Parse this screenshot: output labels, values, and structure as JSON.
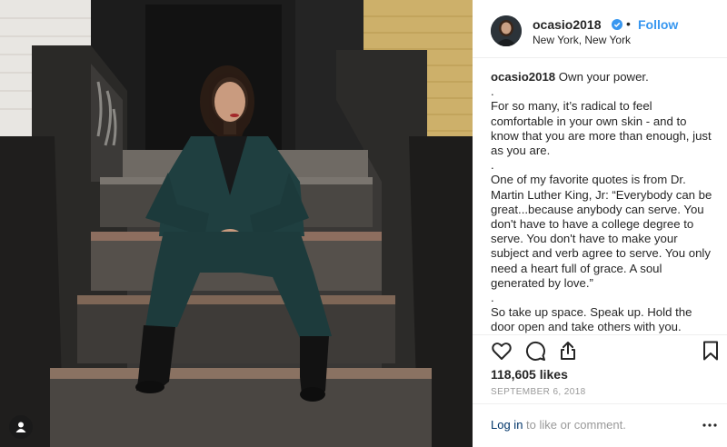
{
  "post": {
    "username": "ocasio2018",
    "follow_label": "Follow",
    "separator": "•",
    "location": "New York, New York",
    "caption_username": "ocasio2018",
    "caption_lines": [
      " Own your power.",
      ".",
      "For so many, it’s radical to feel comfortable in your own skin - and to know that you are more than enough, just as you are.",
      ".",
      "One of my favorite quotes is from Dr. Martin Luther King, Jr: “Everybody can be great...because anybody can serve. You don't have to have a college degree to serve. You don't have to make your subject and verb agree to serve. You only need a heart full of grace. A soul generated by love.”",
      ".",
      "So take up space. Speak up. Hold the door open and take others with you. Accept that you will be criticized no matter what - that is the price of fighting for change and"
    ],
    "likes": "118,605 likes",
    "date": "SEPTEMBER 6, 2018",
    "login_link": "Log in",
    "login_suffix": " to like or comment."
  },
  "icons": {
    "verified": "verified-badge-icon",
    "like": "heart-icon",
    "comment": "comment-icon",
    "share": "share-icon",
    "save": "bookmark-icon",
    "more": "more-options-icon",
    "tagged": "user-tag-icon"
  },
  "colors": {
    "link": "#3897f0",
    "verified": "#3897f0",
    "muted": "#999999",
    "text": "#262626"
  }
}
